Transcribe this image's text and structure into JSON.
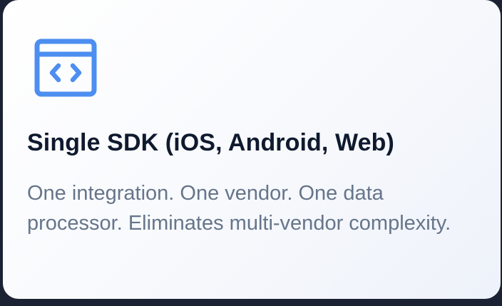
{
  "card": {
    "icon": "code-window-icon",
    "icon_color": "#4d8ff0",
    "title": "Single SDK (iOS, Android, Web)",
    "description": "One integration. One vendor. One data processor. Eliminates multi-vendor complexity."
  }
}
